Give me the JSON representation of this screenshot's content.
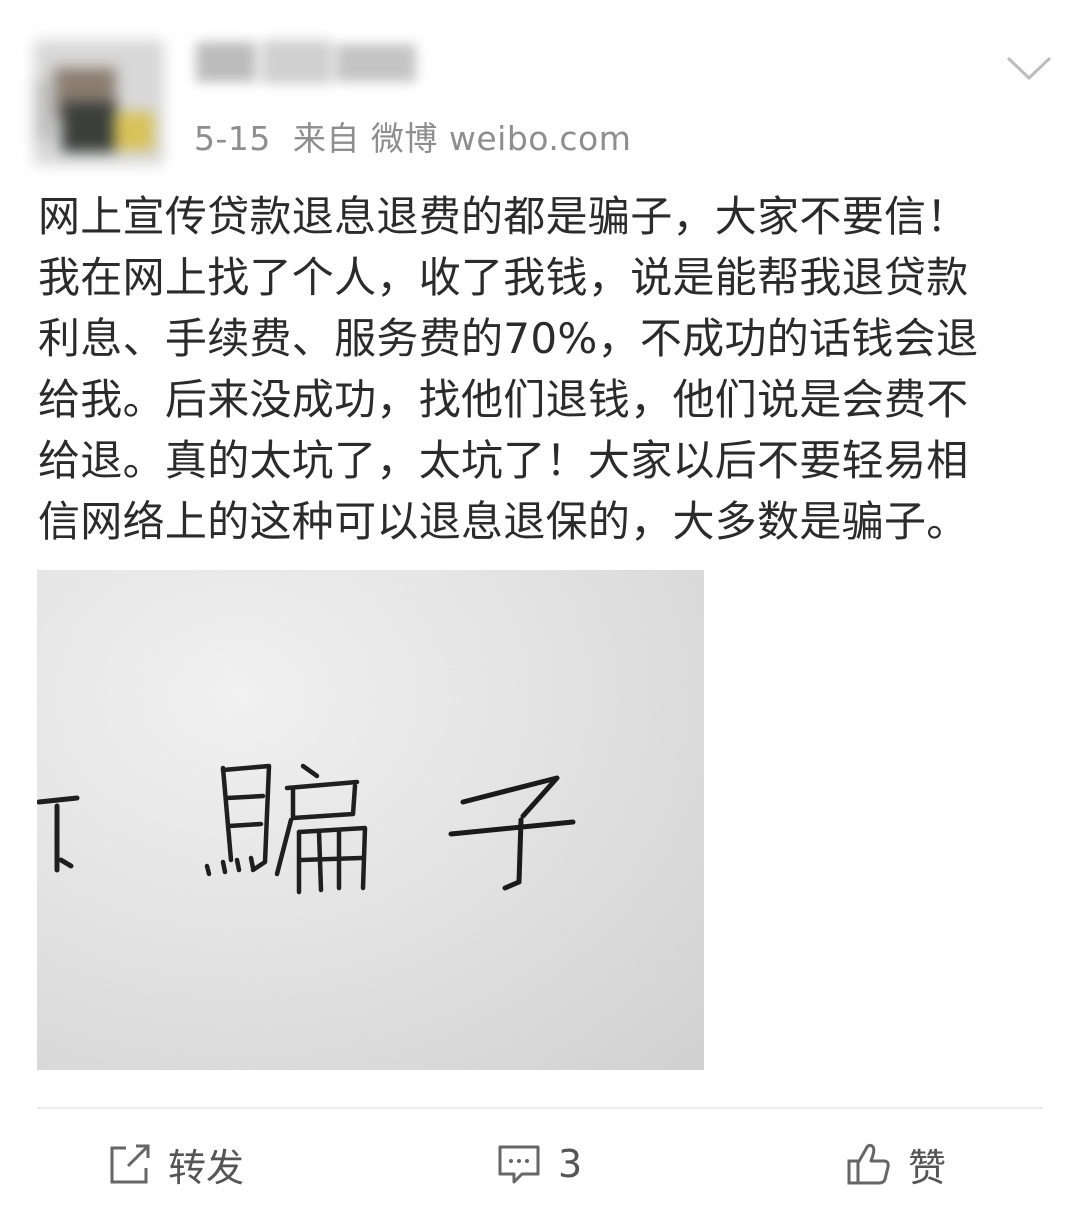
{
  "post": {
    "date": "5-15",
    "source": "来自 微博 weibo.com",
    "text": "网上宣传贷款退息退费的都是骗子，大家不要信！\n我在网上找了个人，收了我钱，说是能帮我退贷款\n利息、手续费、服务费的70%，不成功的话钱会退\n给我。后来没成功，找他们退钱，他们说是会费不\n给退。真的太坑了，太坑了！大家以后不要轻易相\n信网络上的这种可以退息退保的，大多数是骗子。",
    "image": {
      "handwritten_text": "骗子"
    }
  },
  "actions": {
    "repost_label": "转发",
    "comment_count": "3",
    "like_label": "赞"
  },
  "icons": {
    "menu": "chevron-down-icon",
    "repost": "repost-icon",
    "comment": "comment-icon",
    "like": "thumbs-up-icon"
  },
  "colors": {
    "text": "#2b2b2b",
    "meta": "#8e8e8e",
    "icon": "#666666",
    "divider": "#ececec"
  }
}
